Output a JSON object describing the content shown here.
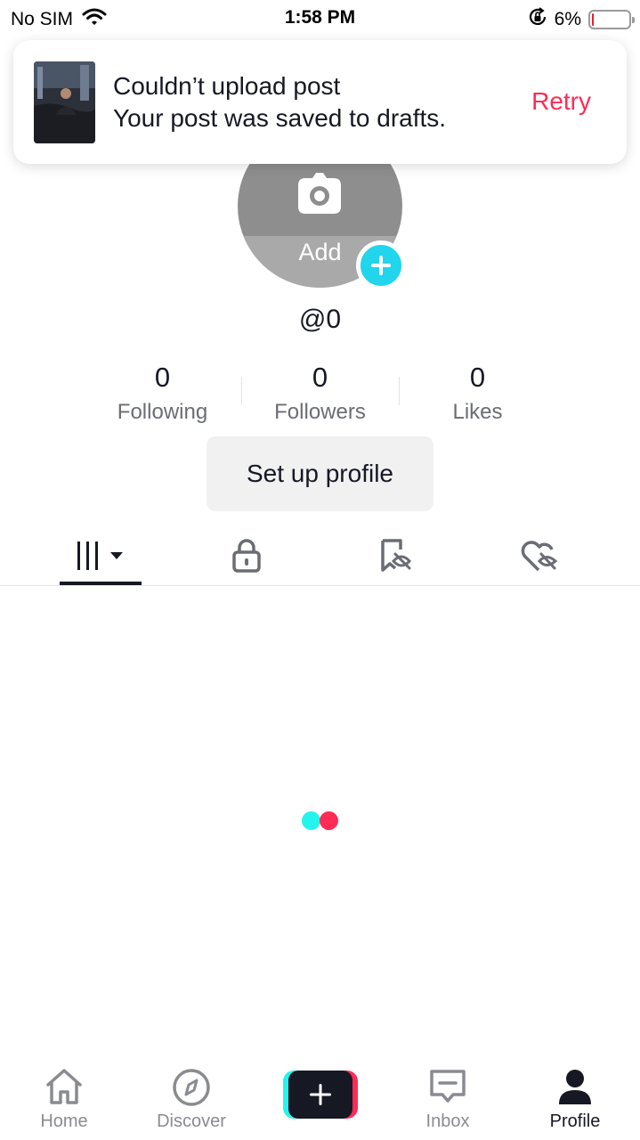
{
  "status_bar": {
    "carrier": "No SIM",
    "time": "1:58 PM",
    "battery_percent": "6%",
    "battery_level": 0.06,
    "icons": [
      "wifi-icon",
      "orientation-lock-icon",
      "battery-icon"
    ]
  },
  "toast": {
    "title": "Couldn’t upload post",
    "message": "Your post was saved to drafts.",
    "action_label": "Retry",
    "action_color": "#fe2c55"
  },
  "profile": {
    "avatar_label": "Add",
    "username": "@0",
    "stats": [
      {
        "value": "0",
        "label": "Following"
      },
      {
        "value": "0",
        "label": "Followers"
      },
      {
        "value": "0",
        "label": "Likes"
      }
    ],
    "setup_button": "Set up profile",
    "accent_color": "#20d5ec"
  },
  "content_tabs": [
    {
      "icon": "videos-grid-icon",
      "active": true
    },
    {
      "icon": "lock-icon",
      "active": false
    },
    {
      "icon": "bookmark-hidden-icon",
      "active": false
    },
    {
      "icon": "heart-hidden-icon",
      "active": false
    }
  ],
  "loader": {
    "colors": [
      "#25f4ee",
      "#fe2c55"
    ]
  },
  "bottom_nav": {
    "items": [
      {
        "label": "Home",
        "icon": "home-icon"
      },
      {
        "label": "Discover",
        "icon": "compass-icon"
      },
      {
        "label": "",
        "icon": "create-plus-icon"
      },
      {
        "label": "Inbox",
        "icon": "inbox-icon"
      },
      {
        "label": "Profile",
        "icon": "profile-icon",
        "active": true
      }
    ]
  }
}
